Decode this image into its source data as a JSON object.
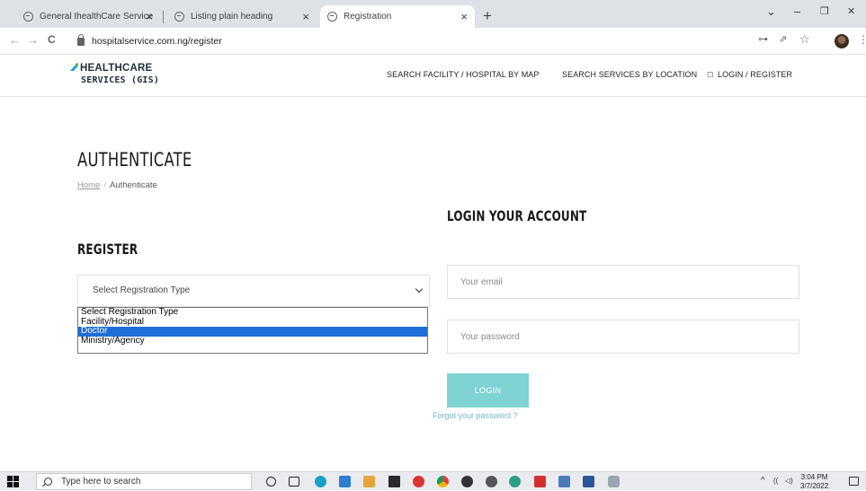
{
  "browser": {
    "tabs": [
      {
        "title": "General IhealthCare Services",
        "active": false
      },
      {
        "title": "Listing plain heading",
        "active": false
      },
      {
        "title": "Registration",
        "active": true
      }
    ],
    "close_glyph": "×",
    "new_tab_glyph": "+",
    "window_controls": {
      "chevron": "⌄",
      "minimize": "–",
      "restore": "❐",
      "close": "✕"
    },
    "nav": {
      "back": "←",
      "forward": "→",
      "reload": "C"
    },
    "url": "hospitalservice.com.ng/register",
    "toolbar_icons": {
      "key": "⊶",
      "share": "⇗",
      "star": "☆",
      "menu": "⋮"
    }
  },
  "site": {
    "logo": {
      "line1": "HEALTHCARE",
      "line2": "SERVICES (GIS)",
      "accent_color": "#19a6d6"
    },
    "nav": [
      {
        "label": "SEARCH FACILITY / HOSPITAL BY MAP"
      },
      {
        "label": "SEARCH SERVICES BY LOCATION"
      },
      {
        "label": "LOGIN / REGISTER",
        "icon": "lock-icon"
      }
    ]
  },
  "page": {
    "title": "AUTHENTICATE",
    "breadcrumb": {
      "home": "Home",
      "separator": "/",
      "current": "Authenticate"
    }
  },
  "register": {
    "heading": "REGISTER",
    "select": {
      "value": "Select Registration Type",
      "options": [
        "Select Registration Type",
        "Facility/Hospital",
        "Doctor",
        "Ministry/Agency"
      ],
      "highlighted": "Doctor"
    }
  },
  "login": {
    "heading": "LOGIN YOUR ACCOUNT",
    "email_placeholder": "Your email",
    "password_placeholder": "Your password",
    "button_label": "LOGIN",
    "forgot_label": "Forgot your password ?",
    "button_color": "#7fd3d3"
  },
  "taskbar": {
    "search_placeholder": "Type here to search",
    "time": "3:04 PM",
    "date": "3/7/2022",
    "tray_glyphs": {
      "chevron": "^",
      "network": "((",
      "volume": "◁)"
    }
  }
}
